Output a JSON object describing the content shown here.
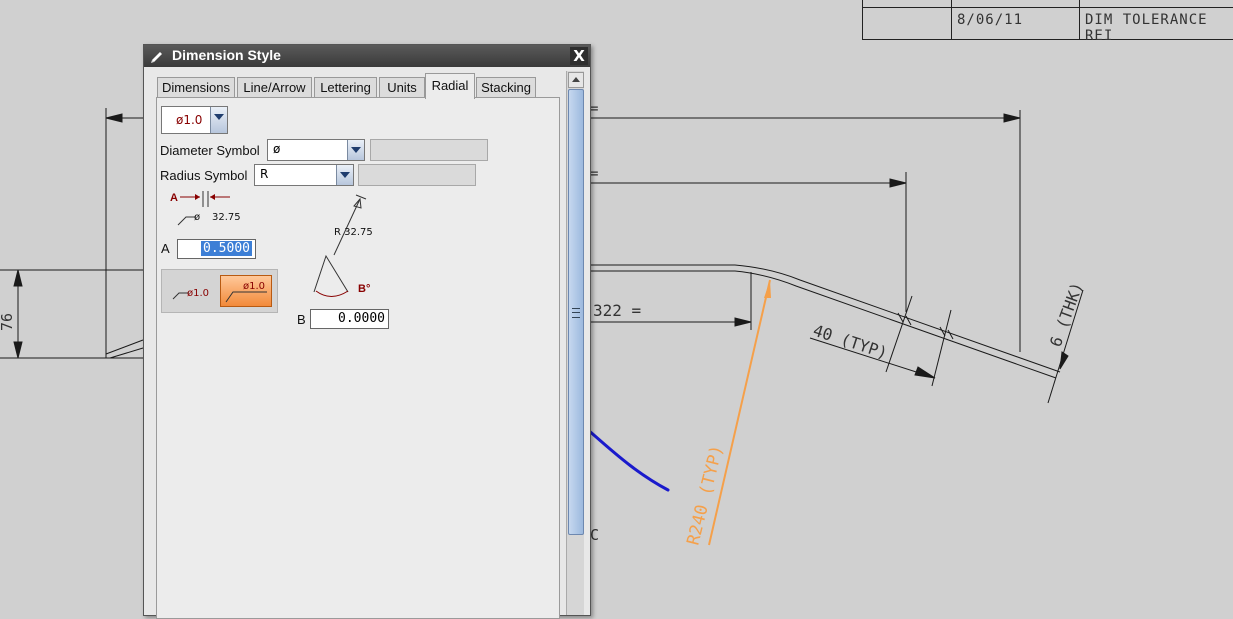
{
  "drawing": {
    "titleblock": {
      "date": "8/06/11",
      "description": "DIM  TOLERANCE REI"
    },
    "dim_322": "322 =",
    "dim_76": "76",
    "dim_40_typ": "40 (TYP)",
    "dim_6_thk": "6 (THK)",
    "radius_note": "R240 (TYP)",
    "eq1": "=",
    "eq2": "=",
    "paren": "C",
    "colors": {
      "dimension_line": "#1a1a1a",
      "annotation_orange": "#f5a04a",
      "markup_blue": "#1a1acc",
      "background": "#d0d0d0"
    }
  },
  "dialog": {
    "title": "Dimension Style",
    "close_label": "X",
    "tabs": [
      {
        "label": "Dimensions"
      },
      {
        "label": "Line/Arrow"
      },
      {
        "label": "Lettering"
      },
      {
        "label": "Units"
      },
      {
        "label": "Radial",
        "active": true
      },
      {
        "label": "Stacking"
      }
    ],
    "radial": {
      "dim_type_value": "ø1.0",
      "diameter_symbol_label": "Diameter Symbol",
      "diameter_symbol_value": "ø",
      "radius_symbol_label": "Radius Symbol",
      "radius_symbol_value": "R",
      "diagram_a_label": "A",
      "diagram_dim_text": "32.75",
      "diagram_dia_symbol": "ø",
      "a_label": "A",
      "a_value": "0.5000",
      "diagram_radius_text": "R 32.75",
      "diagram_b_label": "B°",
      "b_label": "B",
      "b_value": "0.0000",
      "toggle_left_label": "ø1.0",
      "toggle_right_label": "ø1.0"
    }
  }
}
